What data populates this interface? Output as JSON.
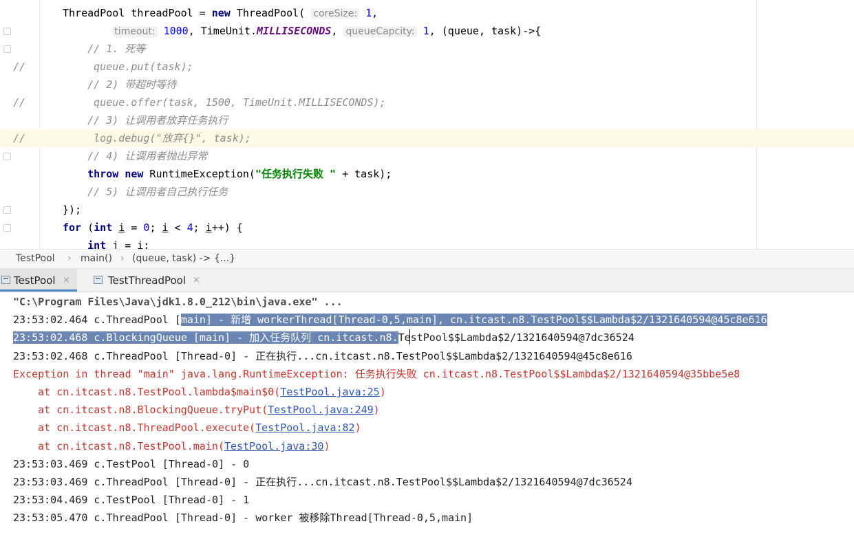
{
  "editor": {
    "lines": [
      {
        "segments": [
          [
            "ThreadPool threadPool = ",
            ""
          ],
          [
            "new",
            "kw"
          ],
          [
            " ThreadPool( ",
            ""
          ],
          [
            "coreSize:",
            "hint"
          ],
          [
            " ",
            ""
          ],
          [
            "1",
            "num"
          ],
          [
            ",",
            ""
          ]
        ]
      },
      {
        "segments": [
          [
            "        ",
            ""
          ],
          [
            "timeout:",
            "hint"
          ],
          [
            " ",
            ""
          ],
          [
            "1000",
            "num"
          ],
          [
            ", TimeUnit.",
            ""
          ],
          [
            "MILLISECONDS",
            "konst"
          ],
          [
            ", ",
            ""
          ],
          [
            "queueCapcity:",
            "hint"
          ],
          [
            " ",
            ""
          ],
          [
            "1",
            "num"
          ],
          [
            ", (queue, task)->{",
            ""
          ]
        ]
      },
      {
        "segments": [
          [
            "    // 1. 死等",
            "cmt"
          ]
        ]
      },
      {
        "comment_marker": "//",
        "segments": [
          [
            "     queue.put(task);",
            "cmt"
          ]
        ]
      },
      {
        "segments": [
          [
            "    // 2) 带超时等待",
            "cmt"
          ]
        ]
      },
      {
        "comment_marker": "//",
        "segments": [
          [
            "     queue.offer(task, 1500, TimeUnit.MILLISECONDS);",
            "cmt"
          ]
        ]
      },
      {
        "segments": [
          [
            "    // 3) 让调用者放弃任务执行",
            "cmt"
          ]
        ]
      },
      {
        "comment_marker": "//",
        "highlight": true,
        "segments": [
          [
            "     log.debug(\"放弃{}\", task);",
            "cmt"
          ]
        ]
      },
      {
        "segments": [
          [
            "    // 4) 让调用者抛出异常",
            "cmt"
          ]
        ]
      },
      {
        "segments": [
          [
            "    ",
            ""
          ],
          [
            "throw",
            "kw"
          ],
          [
            " ",
            ""
          ],
          [
            "new",
            "kw"
          ],
          [
            " RuntimeException(",
            ""
          ],
          [
            "\"任务执行失败 \"",
            "str"
          ],
          [
            " + task);",
            ""
          ]
        ]
      },
      {
        "segments": [
          [
            "    // 5) 让调用者自己执行任务",
            "cmt"
          ]
        ]
      },
      {
        "segments": [
          [
            "});",
            ""
          ]
        ]
      },
      {
        "segments": [
          [
            "for",
            "kw"
          ],
          [
            " (",
            ""
          ],
          [
            "int",
            "kw"
          ],
          [
            " ",
            ""
          ],
          [
            "i",
            "ul"
          ],
          [
            " = ",
            ""
          ],
          [
            "0",
            "num"
          ],
          [
            "; ",
            ""
          ],
          [
            "i",
            "ul"
          ],
          [
            " < ",
            ""
          ],
          [
            "4",
            "num"
          ],
          [
            "; ",
            ""
          ],
          [
            "i",
            "ul"
          ],
          [
            "++) {",
            ""
          ]
        ]
      },
      {
        "segments": [
          [
            "    ",
            ""
          ],
          [
            "int",
            "kw"
          ],
          [
            " j = i;",
            ""
          ]
        ]
      }
    ]
  },
  "breadcrumb": {
    "items": [
      "TestPool",
      "main()",
      "(queue, task) -> {...}"
    ],
    "separator": "›"
  },
  "run_tabs": [
    {
      "label": "TestPool",
      "active": true,
      "close": "×"
    },
    {
      "label": "TestThreadPool",
      "active": false,
      "close": "×"
    }
  ],
  "console": {
    "lines": [
      {
        "kind": "cmd",
        "segments": [
          [
            "\"C:\\Program Files\\Java\\jdk1.8.0_212\\bin\\java.exe\" ...",
            ""
          ]
        ]
      },
      {
        "kind": "log",
        "segments": [
          [
            "23:53:02.464 c.ThreadPool [",
            ""
          ],
          [
            "main] - 新增 workerThread[Thread-0,5,main], cn.itcast.n8.TestPool$$Lambda$2/1321640594@45c8e616",
            "sel"
          ]
        ]
      },
      {
        "kind": "log",
        "segments": [
          [
            "23:53:02.468 c.BlockingQueue [main] - 加入任务队列 cn.itcast.n8.",
            "sel"
          ],
          [
            "TestPool$$Lambda$2/1321640594@7dc36524",
            ""
          ]
        ]
      },
      {
        "kind": "log",
        "segments": [
          [
            "23:53:02.468 c.ThreadPool [Thread-0] - 正在执行...cn.itcast.n8.TestPool$$Lambda$2/1321640594@45c8e616",
            ""
          ]
        ]
      },
      {
        "kind": "err",
        "segments": [
          [
            "Exception in thread \"main\" java.lang.RuntimeException: 任务执行失败 cn.itcast.n8.TestPool$$Lambda$2/1321640594@35bbe5e8",
            "err"
          ]
        ]
      },
      {
        "kind": "trace",
        "segments": [
          [
            "at cn.itcast.n8.TestPool.lambda$main$0(",
            "err"
          ],
          [
            "TestPool.java:25",
            "link"
          ],
          [
            ")",
            "err"
          ]
        ]
      },
      {
        "kind": "trace",
        "segments": [
          [
            "at cn.itcast.n8.BlockingQueue.tryPut(",
            "err"
          ],
          [
            "TestPool.java:249",
            "link"
          ],
          [
            ")",
            "err"
          ]
        ]
      },
      {
        "kind": "trace",
        "segments": [
          [
            "at cn.itcast.n8.ThreadPool.execute(",
            "err"
          ],
          [
            "TestPool.java:82",
            "link"
          ],
          [
            ")",
            "err"
          ]
        ]
      },
      {
        "kind": "trace",
        "segments": [
          [
            "at cn.itcast.n8.TestPool.main(",
            "err"
          ],
          [
            "TestPool.java:30",
            "link"
          ],
          [
            ")",
            "err"
          ]
        ]
      },
      {
        "kind": "log",
        "segments": [
          [
            "23:53:03.469 c.TestPool [Thread-0] - 0",
            ""
          ]
        ]
      },
      {
        "kind": "log",
        "segments": [
          [
            "23:53:03.469 c.ThreadPool [Thread-0] - 正在执行...cn.itcast.n8.TestPool$$Lambda$2/1321640594@7dc36524",
            ""
          ]
        ]
      },
      {
        "kind": "log",
        "segments": [
          [
            "23:53:04.469 c.TestPool [Thread-0] - 1",
            ""
          ]
        ]
      },
      {
        "kind": "log",
        "segments": [
          [
            "23:53:05.470 c.ThreadPool [Thread-0] - worker 被移除Thread[Thread-0,5,main]",
            ""
          ]
        ]
      }
    ]
  },
  "colors": {
    "selection": "#6b86b3",
    "error_text": "#c4352d",
    "link": "#2f55b6",
    "keyword": "#000080",
    "number": "#0000ff",
    "string": "#008000",
    "comment": "#8c8c8c",
    "tab_underline": "#4a88c7"
  }
}
